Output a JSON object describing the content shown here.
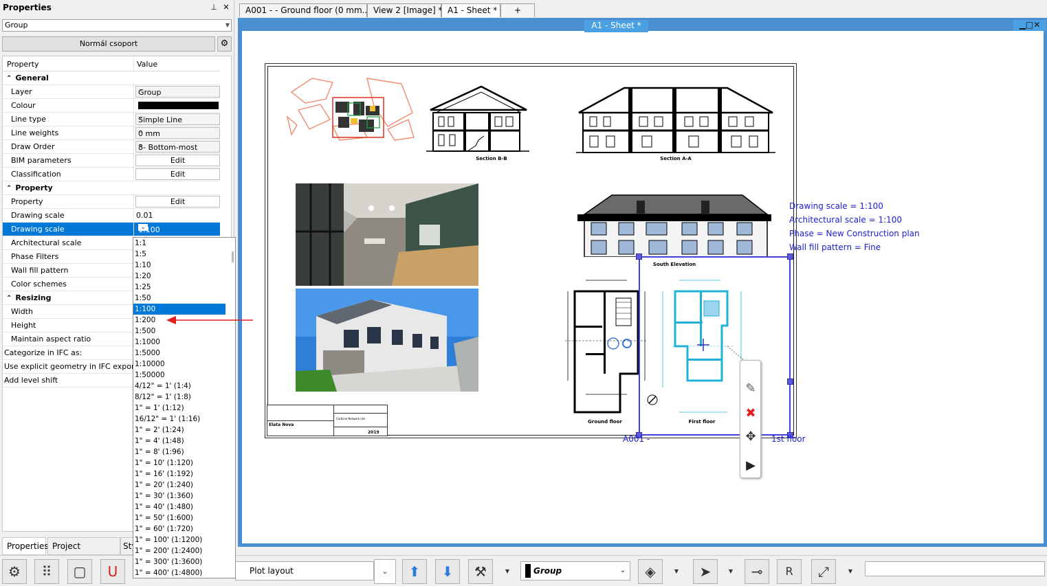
{
  "panel": {
    "title": "Properties",
    "pin_label": "⊥",
    "close_label": "✕",
    "group_select": "Group",
    "normal_group_button": "Normál csoport",
    "header": {
      "property": "Property",
      "value": "Value"
    },
    "rows": [
      {
        "type": "cat",
        "name": "General"
      },
      {
        "type": "combo",
        "name": "Layer",
        "value": "Group"
      },
      {
        "type": "color",
        "name": "Colour",
        "value": "#000000"
      },
      {
        "type": "combo",
        "name": "Line type",
        "value": "Simple Line"
      },
      {
        "type": "combo",
        "name": "Line weights",
        "value": "0 mm"
      },
      {
        "type": "combo",
        "name": "Draw Order",
        "value": "8- Bottom-most"
      },
      {
        "type": "edit",
        "name": "BIM parameters",
        "value": "Edit"
      },
      {
        "type": "edit",
        "name": "Classification",
        "value": "Edit"
      },
      {
        "type": "cat",
        "name": "Property"
      },
      {
        "type": "edit",
        "name": "Property",
        "value": "Edit"
      },
      {
        "type": "text",
        "name": "Drawing scale",
        "value": "0.01"
      },
      {
        "type": "sel",
        "name": "Drawing scale",
        "value": "1:100"
      },
      {
        "type": "text",
        "name": "Architectural scale",
        "value": ""
      },
      {
        "type": "text",
        "name": "Phase Filters",
        "value": ""
      },
      {
        "type": "text",
        "name": "Wall fill pattern",
        "value": ""
      },
      {
        "type": "text",
        "name": "Color schemes",
        "value": ""
      },
      {
        "type": "cat",
        "name": "Resizing"
      },
      {
        "type": "text",
        "name": "Width",
        "value": ""
      },
      {
        "type": "text",
        "name": "Height",
        "value": ""
      },
      {
        "type": "text",
        "name": "Maintain aspect ratio",
        "value": ""
      },
      {
        "type": "wide",
        "name": "Categorize in IFC as:",
        "value": ""
      },
      {
        "type": "wide",
        "name": "Use explicit geometry in IFC export",
        "value": ""
      },
      {
        "type": "wide",
        "name": "Add level shift",
        "value": ""
      }
    ],
    "scale_options": [
      "1:1",
      "1:5",
      "1:10",
      "1:20",
      "1:25",
      "1:50",
      "1:100",
      "1:200",
      "1:500",
      "1:1000",
      "1:5000",
      "1:10000",
      "1:50000",
      "4/12\" = 1' (1:4)",
      "8/12\" = 1' (1:8)",
      "1\" = 1' (1:12)",
      "16/12\" = 1' (1:16)",
      "1\" = 2' (1:24)",
      "1\" = 4' (1:48)",
      "1\" = 8' (1:96)",
      "1\" = 10' (1:120)",
      "1\" = 16' (1:192)",
      "1\" = 20' (1:240)",
      "1\" = 30' (1:360)",
      "1\" = 40' (1:480)",
      "1\" = 50' (1:600)",
      "1\" = 60' (1:720)",
      "1\" = 100' (1:1200)",
      "1\" = 200' (1:2400)",
      "1\" = 300' (1:3600)",
      "1\" = 400' (1:4800)"
    ],
    "selected_option": "1:100",
    "bottom_tabs": [
      "Properties",
      "Project navigator",
      "Sty"
    ]
  },
  "doc_tabs": [
    "A001 -  - Ground floor (0 mm...",
    "View 2 [Image] *",
    "A1 - Sheet *",
    "+"
  ],
  "sheet_tab": "A1 - Sheet *",
  "window_controls": "▁□✕",
  "drawing": {
    "section_bb": "Section B-B",
    "section_aa": "Section A-A",
    "south_elevation": "South Elevation",
    "ground_floor": "Ground floor",
    "first_floor": "First floor",
    "title_block_name": "Elata Nova",
    "title_block_year": "2019",
    "title_block_company": "CadLine Network Ltd.",
    "floor_label_left": "A001 -",
    "floor_label_right": "1st floor"
  },
  "info": [
    "Drawing scale = 1:100",
    "Architectural scale = 1:100",
    "Phase = New Construction plan",
    "Wall fill pattern = Fine"
  ],
  "toolbar": {
    "plot_layout": "Plot layout",
    "layer": "Group"
  },
  "colors": {
    "accent": "#0078d7",
    "viewframe": "#4a8fd0",
    "info_text": "#2020d0"
  }
}
